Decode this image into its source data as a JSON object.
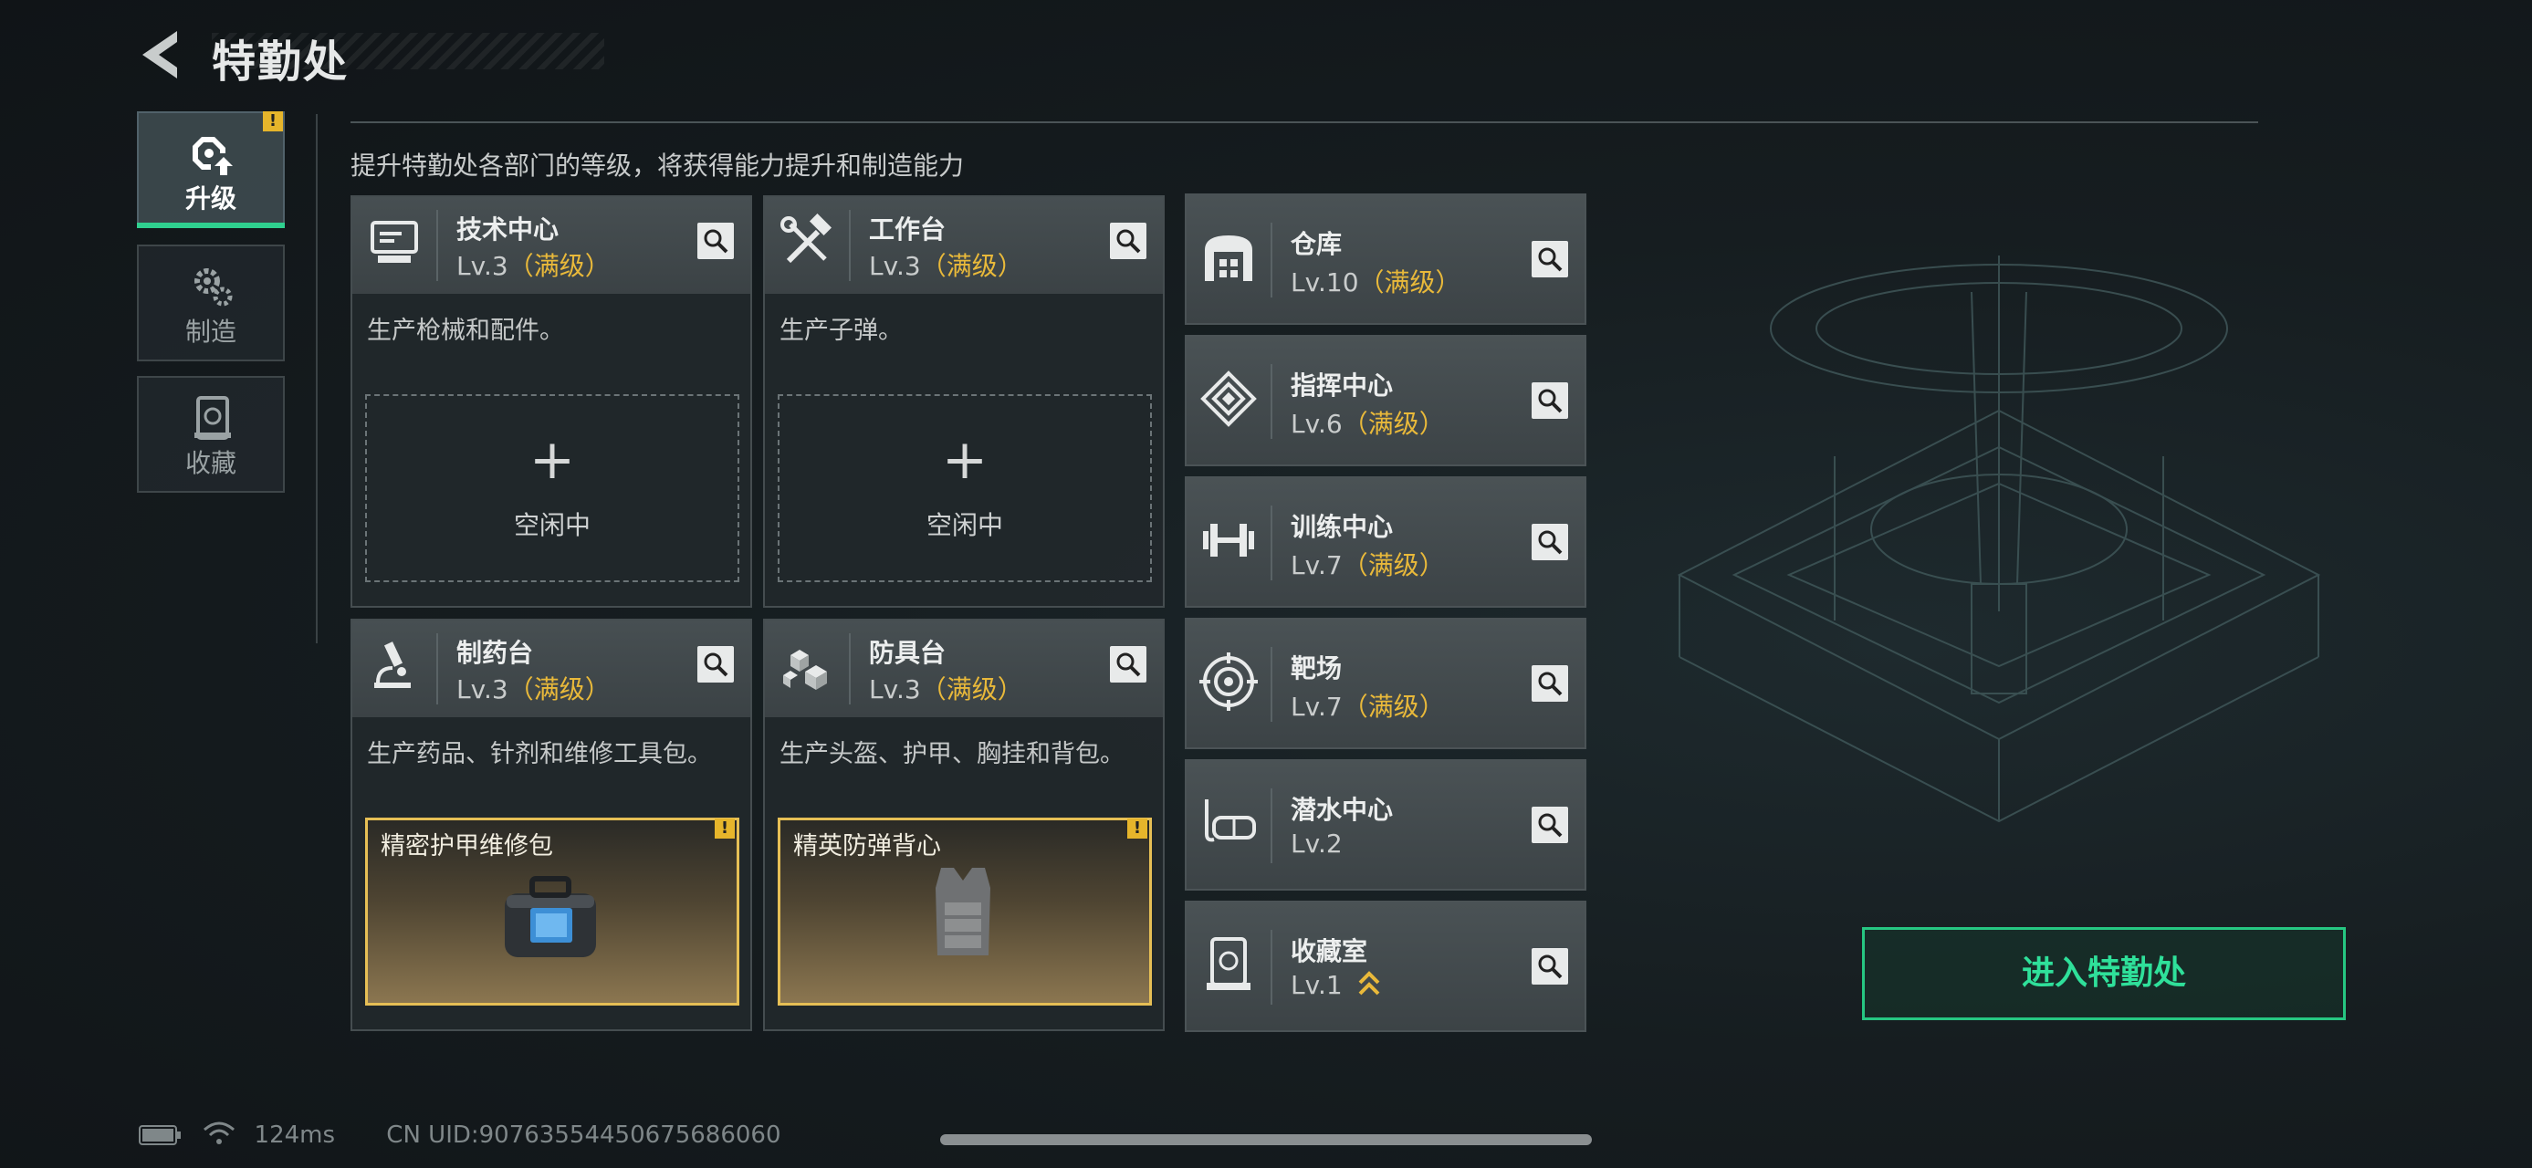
{
  "header": {
    "title": "特勤处"
  },
  "tabs": [
    {
      "label": "升级",
      "active": true,
      "badge": "!"
    },
    {
      "label": "制造",
      "active": false
    },
    {
      "label": "收藏",
      "active": false
    }
  ],
  "subtitle": "提升特勤处各部门的等级，将获得能力提升和制造能力",
  "departments": [
    {
      "name": "技术中心",
      "level": "Lv.3",
      "max": "（满级）",
      "desc": "生产枪械和配件。",
      "slot": {
        "state": "idle",
        "label": "空闲中",
        "plus": "+"
      }
    },
    {
      "name": "工作台",
      "level": "Lv.3",
      "max": "（满级）",
      "desc": "生产子弹。",
      "slot": {
        "state": "idle",
        "label": "空闲中",
        "plus": "+"
      }
    },
    {
      "name": "制药台",
      "level": "Lv.3",
      "max": "（满级）",
      "desc": "生产药品、针剂和维修工具包。",
      "slot": {
        "state": "product",
        "label": "精密护甲维修包",
        "badge": "!"
      }
    },
    {
      "name": "防具台",
      "level": "Lv.3",
      "max": "（满级）",
      "desc": "生产头盔、护甲、胸挂和背包。",
      "slot": {
        "state": "product",
        "label": "精英防弹背心",
        "badge": "!"
      }
    }
  ],
  "facilities": [
    {
      "name": "仓库",
      "level": "Lv.10",
      "max": "（满级）",
      "icon": "warehouse-icon"
    },
    {
      "name": "指挥中心",
      "level": "Lv.6",
      "max": "（满级）",
      "icon": "command-icon"
    },
    {
      "name": "训练中心",
      "level": "Lv.7",
      "max": "（满级）",
      "icon": "dumbbell-icon"
    },
    {
      "name": "靶场",
      "level": "Lv.7",
      "max": "（满级）",
      "icon": "target-icon"
    },
    {
      "name": "潜水中心",
      "level": "Lv.2",
      "max": "",
      "icon": "diving-mask-icon"
    },
    {
      "name": "收藏室",
      "level": "Lv.1",
      "max": "",
      "icon": "collection-icon",
      "upgradeable": true
    }
  ],
  "enter_button": "进入特勤处",
  "status": {
    "ping": "124ms",
    "uid": "CN UID:90763554450675686060"
  },
  "colors": {
    "accent": "#2fd08f",
    "max_level": "#e9b93a",
    "alert": "#e6b52b"
  }
}
